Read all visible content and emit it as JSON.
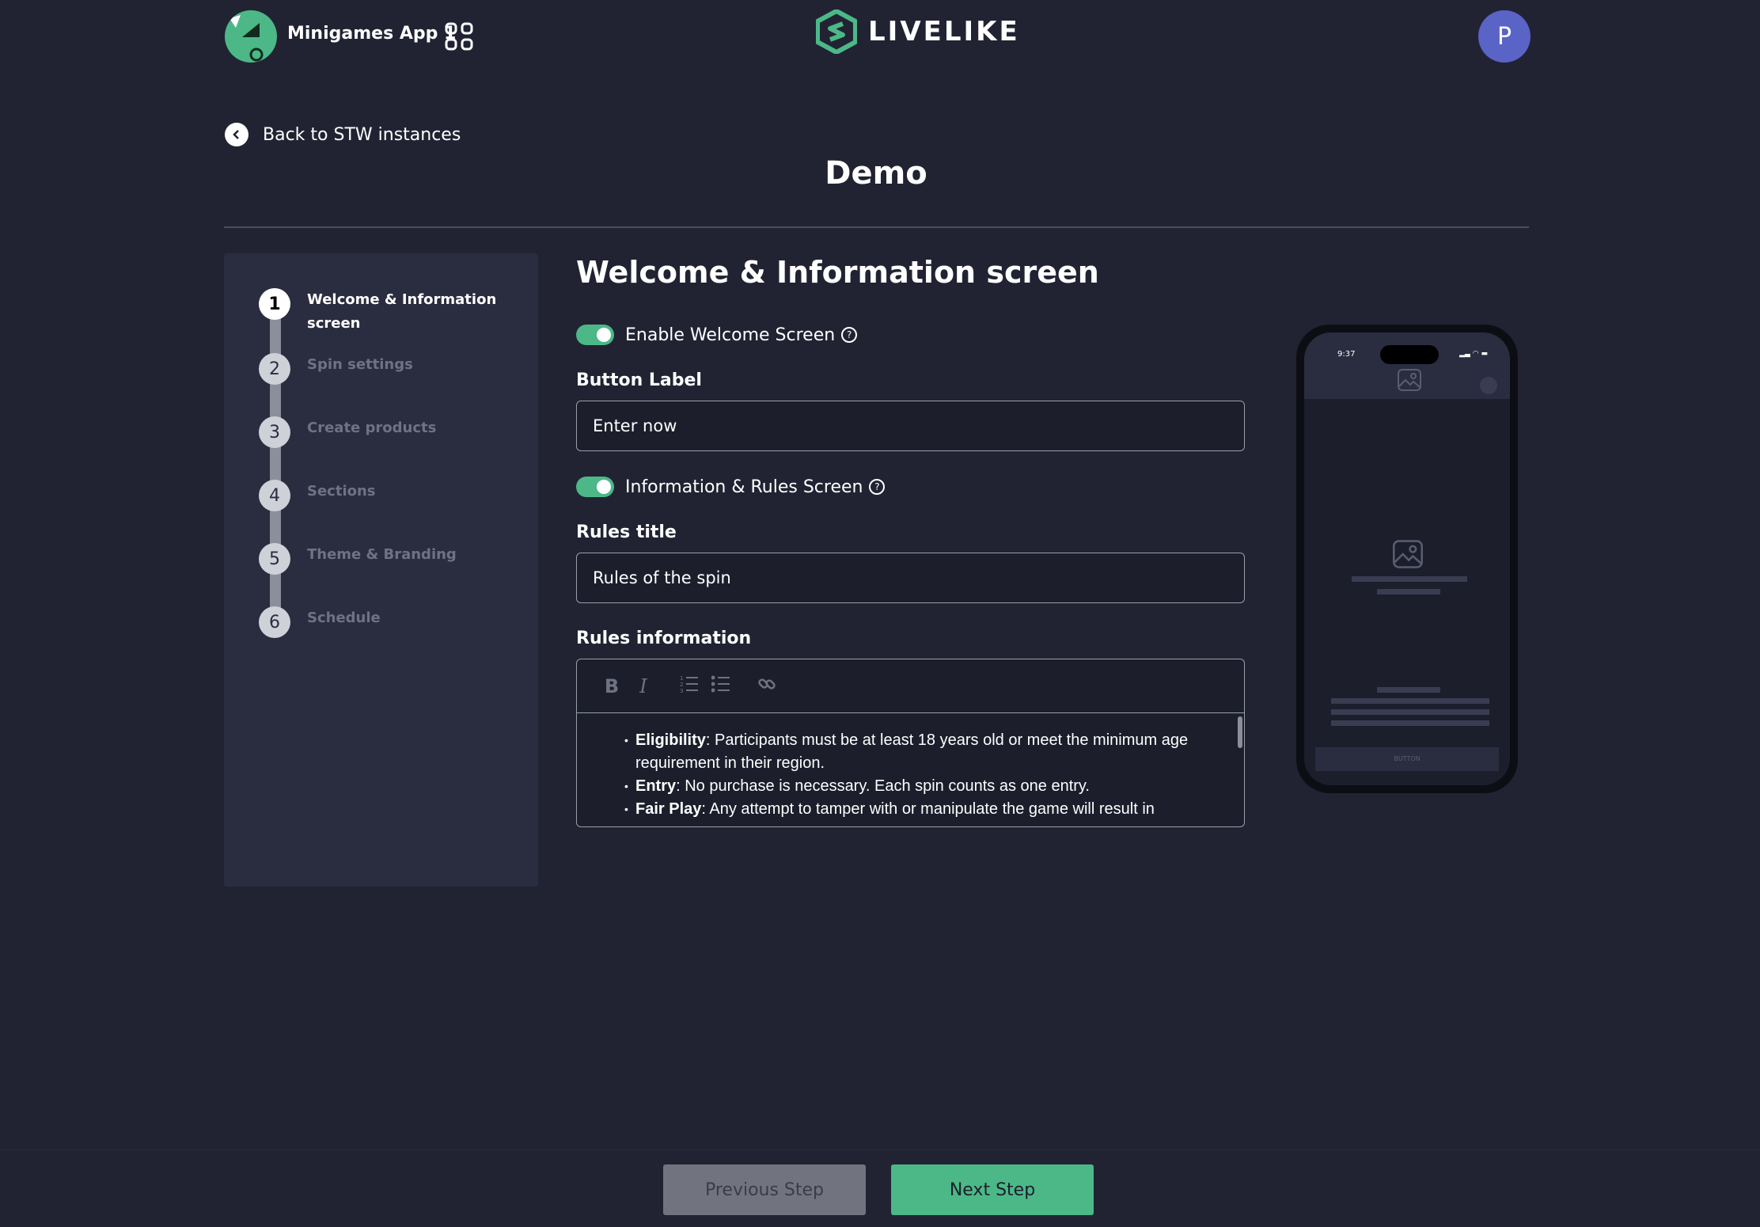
{
  "header": {
    "app_name": "Minigames App 1",
    "brand": "LIVELIKE",
    "avatar_initial": "P",
    "icons": {
      "app_logo": "game-logo-icon",
      "apps": "apps-grid-icon",
      "brand": "livelike-logo-icon"
    }
  },
  "nav": {
    "back_label": "Back to STW instances"
  },
  "page": {
    "title": "Demo"
  },
  "stepper": {
    "steps": [
      {
        "num": "1",
        "label": "Welcome & Information screen",
        "active": true
      },
      {
        "num": "2",
        "label": "Spin settings"
      },
      {
        "num": "3",
        "label": "Create products"
      },
      {
        "num": "4",
        "label": "Sections"
      },
      {
        "num": "5",
        "label": "Theme & Branding"
      },
      {
        "num": "6",
        "label": "Schedule"
      }
    ]
  },
  "form": {
    "title": "Welcome & Information screen",
    "enable_welcome": {
      "label": "Enable Welcome Screen",
      "enabled": true
    },
    "button_label": {
      "label": "Button Label",
      "value": "Enter now"
    },
    "info_rules": {
      "label": "Information & Rules Screen",
      "enabled": true
    },
    "rules_title": {
      "label": "Rules title",
      "value": "Rules of the spin"
    },
    "rules_info": {
      "label": "Rules information",
      "toolbar": {
        "bold": "B",
        "italic": "I"
      },
      "items": [
        {
          "term": "Eligibility",
          "text": ": Participants must be at least 18 years old or meet the minimum age requirement in their region."
        },
        {
          "term": "Entry",
          "text": ": No purchase is necessary. Each spin counts as one entry."
        },
        {
          "term": "Fair Play",
          "text": ": Any attempt to tamper with or manipulate the game will result in"
        }
      ]
    }
  },
  "preview": {
    "time": "9:37",
    "button_label": "BUTTON"
  },
  "footer": {
    "prev_label": "Previous Step",
    "next_label": "Next Step"
  },
  "colors": {
    "accent": "#4cb887",
    "background": "#212333",
    "panel": "#2a2d3f",
    "avatar": "#5a63c6"
  }
}
